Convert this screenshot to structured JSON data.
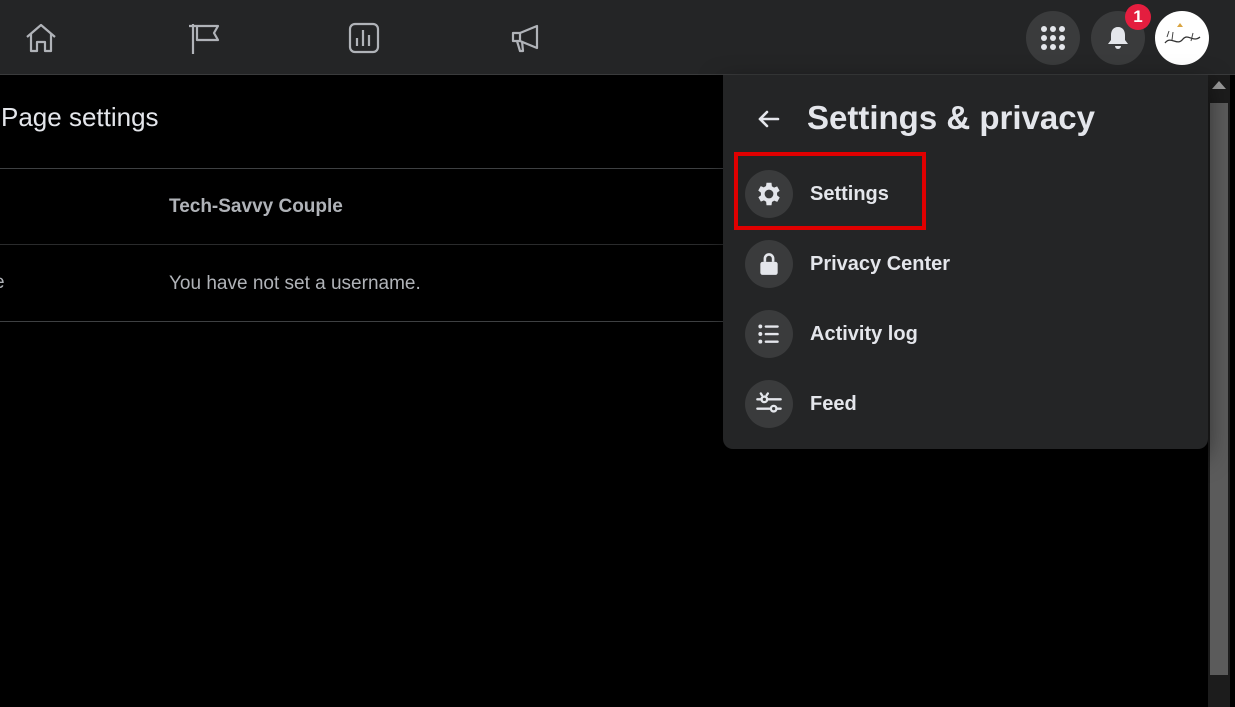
{
  "topbar": {
    "nav": [
      {
        "icon": "home-icon"
      },
      {
        "icon": "flag-icon"
      },
      {
        "icon": "insights-icon"
      },
      {
        "icon": "megaphone-icon"
      }
    ],
    "menu_icon": "grid-menu-icon",
    "notifications_icon": "bell-icon",
    "notification_count": "1",
    "avatar_icon": "page-logo-icon"
  },
  "page": {
    "title": "Page settings",
    "rows": [
      {
        "label": "",
        "value": "Tech-Savvy Couple"
      },
      {
        "label": "e",
        "value": "You have not set a username."
      }
    ]
  },
  "menu": {
    "title": "Settings & privacy",
    "items": [
      {
        "label": "Settings",
        "icon": "gear-icon"
      },
      {
        "label": "Privacy Center",
        "icon": "lock-icon"
      },
      {
        "label": "Activity log",
        "icon": "list-icon"
      },
      {
        "label": "Feed",
        "icon": "sliders-icon"
      }
    ],
    "highlight_color": "#e00000"
  },
  "colors": {
    "topbar_bg": "#242526",
    "menu_bg": "#242526",
    "page_bg": "#000000",
    "badge": "#e41e3f"
  }
}
